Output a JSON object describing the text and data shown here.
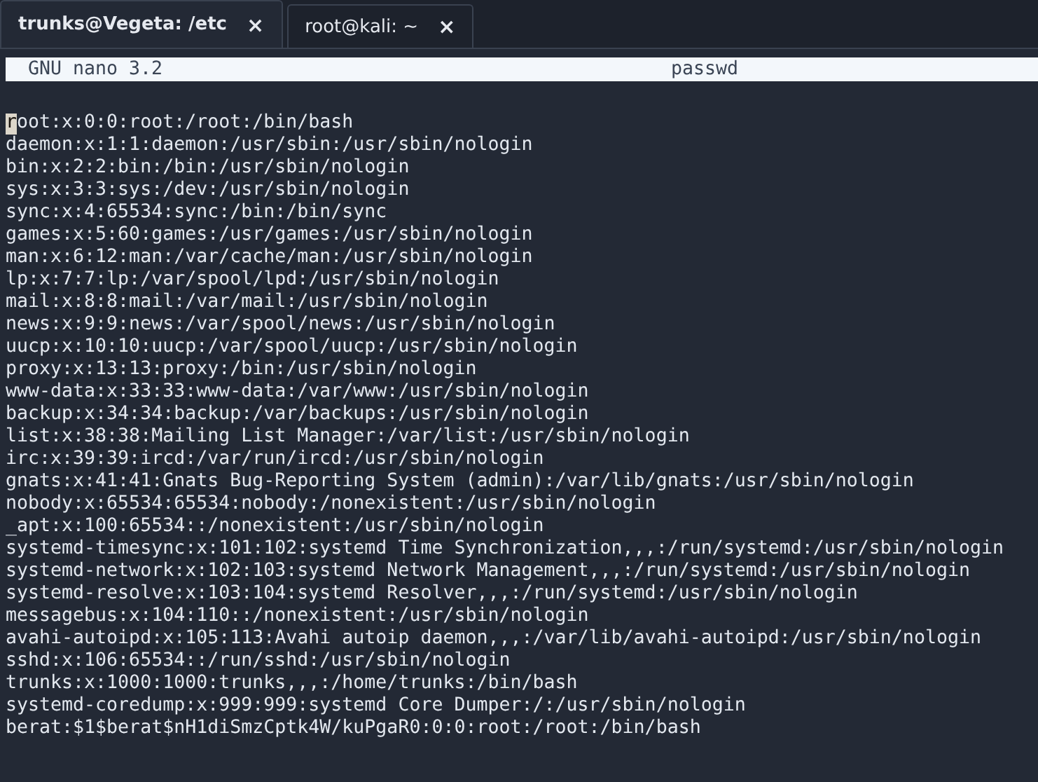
{
  "tabs": [
    {
      "label": "trunks@Vegeta: /etc",
      "close": "×",
      "selected": true
    },
    {
      "label": "root@kali: ~",
      "close": "×",
      "selected": false
    }
  ],
  "nano_header": {
    "version": "GNU nano 3.2",
    "filename": "passwd"
  },
  "lines": [
    {
      "text": "root:x:0:0:root:/root:/bin/bash",
      "cursor": true
    },
    {
      "text": "daemon:x:1:1:daemon:/usr/sbin:/usr/sbin/nologin",
      "cursor": false
    },
    {
      "text": "bin:x:2:2:bin:/bin:/usr/sbin/nologin",
      "cursor": false
    },
    {
      "text": "sys:x:3:3:sys:/dev:/usr/sbin/nologin",
      "cursor": false
    },
    {
      "text": "sync:x:4:65534:sync:/bin:/bin/sync",
      "cursor": false
    },
    {
      "text": "games:x:5:60:games:/usr/games:/usr/sbin/nologin",
      "cursor": false
    },
    {
      "text": "man:x:6:12:man:/var/cache/man:/usr/sbin/nologin",
      "cursor": false
    },
    {
      "text": "lp:x:7:7:lp:/var/spool/lpd:/usr/sbin/nologin",
      "cursor": false
    },
    {
      "text": "mail:x:8:8:mail:/var/mail:/usr/sbin/nologin",
      "cursor": false
    },
    {
      "text": "news:x:9:9:news:/var/spool/news:/usr/sbin/nologin",
      "cursor": false
    },
    {
      "text": "uucp:x:10:10:uucp:/var/spool/uucp:/usr/sbin/nologin",
      "cursor": false
    },
    {
      "text": "proxy:x:13:13:proxy:/bin:/usr/sbin/nologin",
      "cursor": false
    },
    {
      "text": "www-data:x:33:33:www-data:/var/www:/usr/sbin/nologin",
      "cursor": false
    },
    {
      "text": "backup:x:34:34:backup:/var/backups:/usr/sbin/nologin",
      "cursor": false
    },
    {
      "text": "list:x:38:38:Mailing List Manager:/var/list:/usr/sbin/nologin",
      "cursor": false
    },
    {
      "text": "irc:x:39:39:ircd:/var/run/ircd:/usr/sbin/nologin",
      "cursor": false
    },
    {
      "text": "gnats:x:41:41:Gnats Bug-Reporting System (admin):/var/lib/gnats:/usr/sbin/nologin",
      "cursor": false
    },
    {
      "text": "nobody:x:65534:65534:nobody:/nonexistent:/usr/sbin/nologin",
      "cursor": false
    },
    {
      "text": "_apt:x:100:65534::/nonexistent:/usr/sbin/nologin",
      "cursor": false
    },
    {
      "text": "systemd-timesync:x:101:102:systemd Time Synchronization,,,:/run/systemd:/usr/sbin/nologin",
      "cursor": false
    },
    {
      "text": "systemd-network:x:102:103:systemd Network Management,,,:/run/systemd:/usr/sbin/nologin",
      "cursor": false
    },
    {
      "text": "systemd-resolve:x:103:104:systemd Resolver,,,:/run/systemd:/usr/sbin/nologin",
      "cursor": false
    },
    {
      "text": "messagebus:x:104:110::/nonexistent:/usr/sbin/nologin",
      "cursor": false
    },
    {
      "text": "avahi-autoipd:x:105:113:Avahi autoip daemon,,,:/var/lib/avahi-autoipd:/usr/sbin/nologin",
      "cursor": false
    },
    {
      "text": "sshd:x:106:65534::/run/sshd:/usr/sbin/nologin",
      "cursor": false
    },
    {
      "text": "trunks:x:1000:1000:trunks,,,:/home/trunks:/bin/bash",
      "cursor": false
    },
    {
      "text": "systemd-coredump:x:999:999:systemd Core Dumper:/:/usr/sbin/nologin",
      "cursor": false
    },
    {
      "text": "berat:$1$berat$nH1diSmzCptk4W/kuPgaR0:0:0:root:/root:/bin/bash",
      "cursor": false
    }
  ]
}
